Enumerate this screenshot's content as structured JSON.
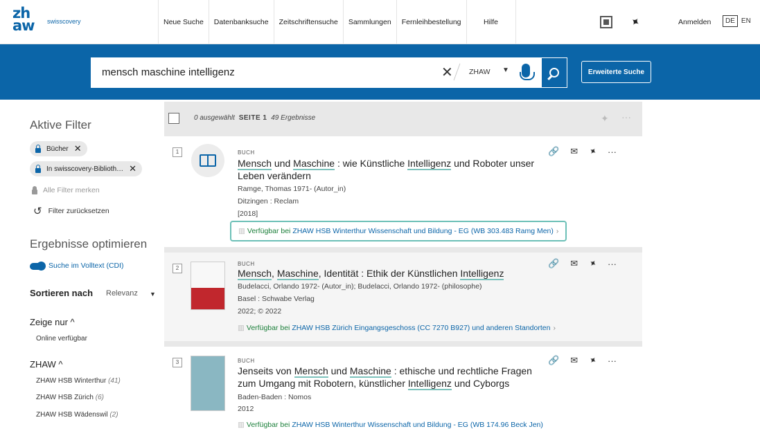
{
  "header": {
    "logo_line1": "zh",
    "logo_line2": "aw",
    "brand": "swisscovery",
    "nav": [
      "Neue Suche",
      "Datenbanksuche",
      "Zeitschriftensuche",
      "Sammlungen",
      "Fernleihbestellung",
      "Hilfe"
    ],
    "login": "Anmelden",
    "lang_active": "DE",
    "lang_other": "EN"
  },
  "search": {
    "query": "mensch maschine intelligenz",
    "scope": "ZHAW",
    "advanced_label": "Erweiterte Suche"
  },
  "sidebar": {
    "active_filters_title": "Aktive Filter",
    "chips": [
      "Bücher",
      "In swisscovery-Biblioth…"
    ],
    "remember_filters": "Alle Filter merken",
    "reset_filters": "Filter zurücksetzen",
    "optimize_title": "Ergebnisse optimieren",
    "fulltext_toggle": "Suche im Volltext (CDI)",
    "sort_label": "Sortieren nach",
    "sort_value": "Relevanz",
    "show_only_label": "Zeige nur",
    "show_only_item": "Online verfügbar",
    "zhaw_label": "ZHAW",
    "libraries": [
      {
        "name": "ZHAW HSB Winterthur",
        "count": "(41)"
      },
      {
        "name": "ZHAW HSB Zürich",
        "count": "(6)"
      },
      {
        "name": "ZHAW HSB Wädenswil",
        "count": "(2)"
      }
    ]
  },
  "results_bar": {
    "selected": "0 ausgewählt",
    "page": "SEITE 1",
    "count": "49 Ergebnisse"
  },
  "results": [
    {
      "num": "1",
      "type": "BUCH",
      "title_parts": [
        "Mensch",
        " und ",
        "Maschine",
        " : wie Künstliche ",
        "Intelligenz",
        " und Roboter unser Leben verändern"
      ],
      "author": "Ramge, Thomas 1971- (Autor_in)",
      "publisher": "Ditzingen : Reclam",
      "year": "[2018]",
      "avail_prefix": "Verfügbar bei ",
      "avail_lib": "ZHAW HSB Winterthur  Wissenschaft und Bildung - EG (WB 303.483 Ramg Men)"
    },
    {
      "num": "2",
      "type": "BUCH",
      "title_parts": [
        "Mensch",
        ", ",
        "Maschine",
        ", Identität : Ethik der Künstlichen ",
        "Intelligenz",
        ""
      ],
      "author": "Budelacci, Orlando 1972- (Autor_in); Budelacci, Orlando 1972- (philosophe)",
      "publisher": "Basel : Schwabe Verlag",
      "year": "2022; © 2022",
      "avail_prefix": "Verfügbar bei ",
      "avail_lib": "ZHAW HSB Zürich  Eingangsgeschoss (CC 7270 B927) und anderen Standorten"
    },
    {
      "num": "3",
      "type": "BUCH",
      "title_parts": [
        "Jenseits von ",
        "Mensch",
        " und ",
        "Maschine",
        " : ethische und rechtliche Fragen zum Umgang mit Robotern, künstlicher ",
        "Intelligenz",
        " und Cyborgs"
      ],
      "author": "Baden-Baden : Nomos",
      "publisher": "2012",
      "avail_prefix": "Verfügbar bei ",
      "avail_lib": "ZHAW HSB Winterthur  Wissenschaft und Bildung - EG (WB 174.96 Beck Jen)"
    }
  ]
}
